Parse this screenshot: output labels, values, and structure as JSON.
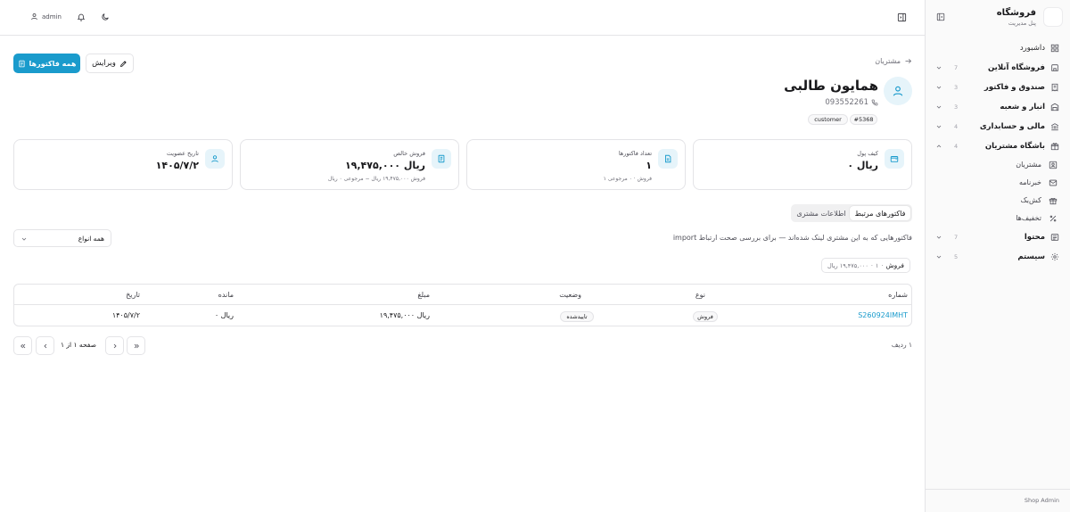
{
  "brand": {
    "name": "فروشگاه",
    "subtitle": "پنل مدیریت"
  },
  "header": {
    "username": "admin"
  },
  "sidebar": {
    "items": [
      {
        "label": "داشبورد",
        "count": "",
        "bold": false
      },
      {
        "label": "فروشگاه آنلاین",
        "count": "7",
        "bold": true
      },
      {
        "label": "صندوق و فاکتور",
        "count": "3",
        "bold": true
      },
      {
        "label": "انبار و شعبه",
        "count": "3",
        "bold": true
      },
      {
        "label": "مالی و حسابداری",
        "count": "4",
        "bold": true
      },
      {
        "label": "باشگاه مشتریان",
        "count": "4",
        "bold": true
      },
      {
        "label": "مشتریان",
        "count": "",
        "bold": false
      },
      {
        "label": "خبرنامه",
        "count": "",
        "bold": false
      },
      {
        "label": "کش‌بک",
        "count": "",
        "bold": false
      },
      {
        "label": "تخفیف‌ها",
        "count": "",
        "bold": false
      },
      {
        "label": "محتوا",
        "count": "7",
        "bold": true
      },
      {
        "label": "سیستم",
        "count": "5",
        "bold": true
      }
    ],
    "footer": "Shop Admin"
  },
  "page": {
    "breadcrumb": "مشتریان",
    "all_invoices_label": "همه فاکتورها",
    "edit_label": "ویرایش",
    "customer": {
      "name": "همایون طالبی",
      "phone": "093552261",
      "id_tag": "#5368",
      "role_tag": "customer"
    }
  },
  "stats": [
    {
      "label": "کیف پول",
      "value": "۰ ریال",
      "sub": ""
    },
    {
      "label": "تعداد فاکتورها",
      "value": "۱",
      "sub": "۱ فروش · ۰ مرجوعی"
    },
    {
      "label": "فروش خالص",
      "value": "۱۹,۴۷۵,۰۰۰ ریال",
      "sub": "فروش ۱۹,۴۷۵,۰۰۰ ریال − مرجوعی ۰ ریال"
    },
    {
      "label": "تاریخ عضویت",
      "value": "۱۴۰۵/۷/۲",
      "sub": ""
    }
  ],
  "tabs": {
    "active": "فاکتورهای مرتبط",
    "inactive": "اطلاعات مشتری"
  },
  "invoices": {
    "description": "فاکتورهایی که به این مشتری لینک شده‌اند — برای بررسی صحت ارتباط import",
    "filter_value": "همه انواع",
    "summary_type": "فروش",
    "summary_count": "۱",
    "summary_amount": "۱۹,۴۷۵,۰۰۰ ریال",
    "columns": {
      "number": "شماره",
      "type": "نوع",
      "status": "وضعیت",
      "amount": "مبلغ",
      "remaining": "مانده",
      "date": "تاریخ"
    },
    "rows": [
      {
        "number": "S260924IMHT",
        "type": "فروش",
        "status": "تاییدشده",
        "amount": "۱۹,۴۷۵,۰۰۰ ریال",
        "remaining": "۰ ریال",
        "date": "۱۴۰۵/۷/۲"
      }
    ],
    "row_count": "۱ ردیف",
    "page_info": "صفحه ۱ از ۱"
  },
  "colors": {
    "accent": "#1a9bcc",
    "accent_soft": "#e6f4fa",
    "border": "#e4e4e7"
  }
}
